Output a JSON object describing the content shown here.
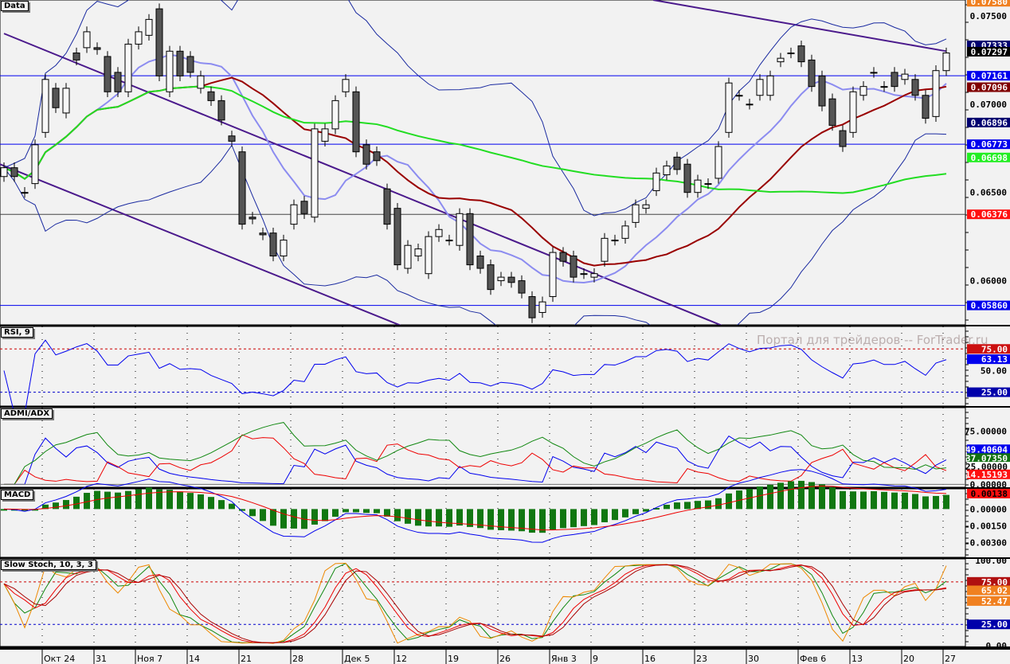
{
  "watermark": "Портал для трейдеров -- ForTrader.ru",
  "panels": {
    "main": "Data",
    "rsi": "RSI, 9",
    "adx": "ADMI/ADX",
    "macd": "MACD",
    "stoch": "Slow Stoch, 10, 3, 3"
  },
  "colors": {
    "bull": "#f8f8f8",
    "bear": "#555555",
    "bb": "#1a2aa0",
    "mid": "#8c8cf0",
    "ma_red": "#990000",
    "ma_green": "#22dd22",
    "trend": "#4b1a8c",
    "hline": "#0000ee"
  },
  "chart_data": [
    {
      "type": "candlestick",
      "panel": "main",
      "title": "Data",
      "ylim": [
        0.0575,
        0.0759
      ],
      "yticks": [
        "0.07500",
        "0.07000",
        "0.06500",
        "0.06000"
      ],
      "ytick_values": [
        0.075,
        0.07,
        0.065,
        0.06
      ],
      "badges": [
        {
          "text": "0.07580",
          "value": 0.0758,
          "bg": "#f08020",
          "fg": "#ffffff"
        },
        {
          "text": "0.07333",
          "value": 0.07333,
          "bg": "#000070",
          "fg": "#ffffff"
        },
        {
          "text": "0.07297",
          "value": 0.07297,
          "bg": "#000000",
          "fg": "#ffffff"
        },
        {
          "text": "0.07161",
          "value": 0.07161,
          "bg": "#0000ee",
          "fg": "#ffffff"
        },
        {
          "text": "0.07096",
          "value": 0.07096,
          "bg": "#800000",
          "fg": "#ffffff"
        },
        {
          "text": "0.06896",
          "value": 0.06896,
          "bg": "#000070",
          "fg": "#ffffff"
        },
        {
          "text": "0.06773",
          "value": 0.06773,
          "bg": "#0000ee",
          "fg": "#ffffff"
        },
        {
          "text": "0.06698",
          "value": 0.06698,
          "bg": "#22ee22",
          "fg": "#ffffff"
        },
        {
          "text": "0.06376",
          "value": 0.06376,
          "bg": "#ff1010",
          "fg": "#ffffff"
        },
        {
          "text": "0.05860",
          "value": 0.0586,
          "bg": "#0000ee",
          "fg": "#ffffff"
        }
      ],
      "hlines": [
        {
          "value": 0.07161,
          "color": "#0000ee"
        },
        {
          "value": 0.06773,
          "color": "#0000ee"
        },
        {
          "value": 0.06376,
          "color": "#444444"
        },
        {
          "value": 0.0586,
          "color": "#0000ee"
        }
      ],
      "trendlines": [
        {
          "from": [
            0,
            0.074
          ],
          "to": [
            70,
            0.0573
          ]
        },
        {
          "from": [
            -0.4,
            0.0666
          ],
          "to": [
            39,
            0.0573
          ]
        },
        {
          "from": [
            62.7,
            0.0759
          ],
          "to": [
            91,
            0.073
          ]
        }
      ],
      "candles_oc": [
        [
          0.0659,
          0.0664
        ],
        [
          0.0664,
          0.0659
        ],
        [
          0.065,
          0.065
        ],
        [
          0.0655,
          0.0677
        ],
        [
          0.0684,
          0.0714
        ],
        [
          0.0709,
          0.0698
        ],
        [
          0.0695,
          0.0709
        ],
        [
          0.0729,
          0.0725
        ],
        [
          0.0732,
          0.0741
        ],
        [
          0.0732,
          0.0731
        ],
        [
          0.0727,
          0.0707
        ],
        [
          0.0718,
          0.0707
        ],
        [
          0.0707,
          0.0734
        ],
        [
          0.0734,
          0.0741
        ],
        [
          0.0739,
          0.0748
        ],
        [
          0.0754,
          0.0716
        ],
        [
          0.0707,
          0.073
        ],
        [
          0.073,
          0.0716
        ],
        [
          0.0727,
          0.0718
        ],
        [
          0.0709,
          0.0716
        ],
        [
          0.0707,
          0.0702
        ],
        [
          0.0702,
          0.0691
        ],
        [
          0.0682,
          0.0679
        ],
        [
          0.0673,
          0.0632
        ],
        [
          0.0636,
          0.0635
        ],
        [
          0.0627,
          0.0626
        ],
        [
          0.0627,
          0.0614
        ],
        [
          0.0614,
          0.0623
        ],
        [
          0.0632,
          0.0643
        ],
        [
          0.0645,
          0.0638
        ],
        [
          0.0636,
          0.0686
        ],
        [
          0.0679,
          0.0686
        ],
        [
          0.0686,
          0.0702
        ],
        [
          0.0707,
          0.0714
        ],
        [
          0.0707,
          0.0673
        ],
        [
          0.0677,
          0.0666
        ],
        [
          0.0673,
          0.0668
        ],
        [
          0.0652,
          0.0632
        ],
        [
          0.0641,
          0.0609
        ],
        [
          0.0607,
          0.062
        ],
        [
          0.0614,
          0.0618
        ],
        [
          0.0604,
          0.0625
        ],
        [
          0.0625,
          0.0629
        ],
        [
          0.0623,
          0.0623
        ],
        [
          0.062,
          0.0638
        ],
        [
          0.0638,
          0.0609
        ],
        [
          0.0614,
          0.0607
        ],
        [
          0.0609,
          0.0595
        ],
        [
          0.06,
          0.0602
        ],
        [
          0.0602,
          0.0599
        ],
        [
          0.06,
          0.0593
        ],
        [
          0.0591,
          0.0579
        ],
        [
          0.0582,
          0.0588
        ],
        [
          0.0591,
          0.0616
        ],
        [
          0.0616,
          0.0611
        ],
        [
          0.0614,
          0.0602
        ],
        [
          0.0604,
          0.0604
        ],
        [
          0.0602,
          0.0604
        ],
        [
          0.0611,
          0.0624
        ],
        [
          0.0623,
          0.0623
        ],
        [
          0.0624,
          0.0631
        ],
        [
          0.0633,
          0.0643
        ],
        [
          0.0641,
          0.0643
        ],
        [
          0.0651,
          0.0661
        ],
        [
          0.066,
          0.0665
        ],
        [
          0.067,
          0.0663
        ],
        [
          0.0666,
          0.065
        ],
        [
          0.065,
          0.0657
        ],
        [
          0.0655,
          0.0655
        ],
        [
          0.0658,
          0.0676
        ],
        [
          0.0684,
          0.0712
        ],
        [
          0.0705,
          0.0705
        ],
        [
          0.07,
          0.07
        ],
        [
          0.0705,
          0.0714
        ],
        [
          0.0705,
          0.0716
        ],
        [
          0.0724,
          0.0726
        ],
        [
          0.0729,
          0.0729
        ],
        [
          0.0733,
          0.0724
        ],
        [
          0.0725,
          0.071
        ],
        [
          0.0716,
          0.0699
        ],
        [
          0.0703,
          0.0688
        ],
        [
          0.0685,
          0.0676
        ],
        [
          0.0684,
          0.0707
        ],
        [
          0.0705,
          0.071
        ],
        [
          0.0718,
          0.0718
        ],
        [
          0.071,
          0.071
        ],
        [
          0.0718,
          0.071
        ],
        [
          0.0714,
          0.0717
        ],
        [
          0.0714,
          0.0705
        ],
        [
          0.0705,
          0.0692
        ],
        [
          0.0693,
          0.0719
        ],
        [
          0.0719,
          0.0729
        ]
      ]
    },
    {
      "type": "line",
      "panel": "rsi",
      "title": "RSI, 9",
      "ylim": [
        9,
        101
      ],
      "levels": [
        {
          "value": 75,
          "color": "#cc0000"
        },
        {
          "value": 25,
          "color": "#0000cc"
        }
      ],
      "yticks": [
        "50.00"
      ],
      "ytick_values": [
        50
      ],
      "badges": [
        {
          "text": "75.00",
          "value": 75,
          "bg": "#cc1010",
          "fg": "#ffffff"
        },
        {
          "text": "63.13",
          "value": 63.13,
          "bg": "#0000ee",
          "fg": "#ffffff"
        },
        {
          "text": "25.00",
          "value": 25,
          "bg": "#0000aa",
          "fg": "#ffffff"
        }
      ]
    },
    {
      "type": "line",
      "panel": "adx",
      "title": "ADMI/ADX",
      "ylim": [
        -4,
        108
      ],
      "yticks": [
        "75.00000",
        "0.00000"
      ],
      "ytick_values": [
        75,
        0
      ],
      "badges": [
        {
          "text": "49.40604",
          "value": 49.40604,
          "bg": "#0000ee",
          "fg": "#ffffff"
        },
        {
          "text": "37.07350",
          "value": 37.0735,
          "bg": "#107010",
          "fg": "#ffffff"
        },
        {
          "text": "25.00000",
          "value": 25,
          "bg": "#ffffff",
          "fg": "#000000"
        },
        {
          "text": "14.15193",
          "value": 14.15193,
          "bg": "#ff1010",
          "fg": "#ffffff"
        }
      ]
    },
    {
      "type": "bar+line",
      "panel": "macd",
      "title": "MACD",
      "ylim": [
        -0.0043,
        0.0018
      ],
      "yticks": [
        "0.00000",
        "-0.00150",
        "-0.00300"
      ],
      "ytick_values": [
        0,
        -0.0015,
        -0.003
      ],
      "badges": [
        {
          "text": "0.00138",
          "value": 0.00138,
          "bg": "#ff1010",
          "fg": "#000000"
        }
      ]
    },
    {
      "type": "line",
      "panel": "stoch",
      "title": "Slow Stoch, 10, 3, 3",
      "ylim": [
        -1,
        102
      ],
      "levels": [
        {
          "value": 75,
          "color": "#cc0000"
        },
        {
          "value": 25,
          "color": "#0000cc"
        }
      ],
      "yticks": [
        "100.00",
        "0.00"
      ],
      "ytick_values": [
        100,
        0
      ],
      "badges": [
        {
          "text": "75.00",
          "value": 75,
          "bg": "#b01010",
          "fg": "#ffffff"
        },
        {
          "text": "65.02",
          "value": 65.02,
          "bg": "#f08020",
          "fg": "#ffffff"
        },
        {
          "text": "52.47",
          "value": 52.47,
          "bg": "#f08020",
          "fg": "#ffffff"
        },
        {
          "text": "25.00",
          "value": 25,
          "bg": "#0000aa",
          "fg": "#ffffff"
        }
      ]
    }
  ],
  "xaxis": {
    "labels": [
      {
        "text": "Окт 24",
        "idx": 4
      },
      {
        "text": "31",
        "idx": 9
      },
      {
        "text": "Ноя 7",
        "idx": 13
      },
      {
        "text": "14",
        "idx": 18
      },
      {
        "text": "21",
        "idx": 23
      },
      {
        "text": "28",
        "idx": 28
      },
      {
        "text": "Дек 5",
        "idx": 33
      },
      {
        "text": "12",
        "idx": 38
      },
      {
        "text": "19",
        "idx": 43
      },
      {
        "text": "26",
        "idx": 48
      },
      {
        "text": "Янв 3",
        "idx": 53
      },
      {
        "text": "9",
        "idx": 57
      },
      {
        "text": "16",
        "idx": 62
      },
      {
        "text": "23",
        "idx": 67
      },
      {
        "text": "30",
        "idx": 72
      },
      {
        "text": "Фев 6",
        "idx": 77
      },
      {
        "text": "13",
        "idx": 82
      },
      {
        "text": "20",
        "idx": 87
      },
      {
        "text": "27",
        "idx": 91
      }
    ]
  }
}
